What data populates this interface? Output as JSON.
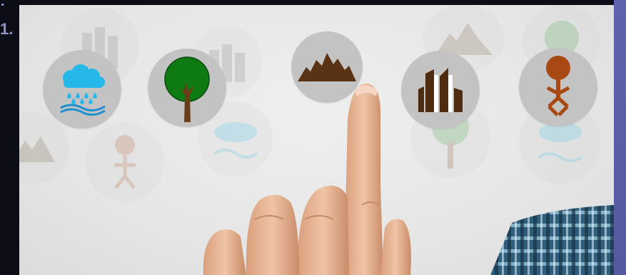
{
  "edge_text": {
    "line1": ":",
    "line2": "1."
  },
  "colors": {
    "bubble": "#c3c3c3",
    "rain_cloud": "#26b8e8",
    "tree_crown": "#0e7a12",
    "tree_trunk": "#6a3e1b",
    "mountain": "#5a3314",
    "building": "#4f2c10",
    "person": "#a84812",
    "skin": "#e8b594",
    "shirt": "#3f6f8f"
  },
  "icons": {
    "main": [
      "rain-icon",
      "tree-icon",
      "mountain-icon",
      "city-buildings-icon",
      "person-icon"
    ],
    "ghost": [
      "city-buildings-icon",
      "mountain-icon",
      "tree-icon",
      "person-icon",
      "rain-icon"
    ]
  }
}
